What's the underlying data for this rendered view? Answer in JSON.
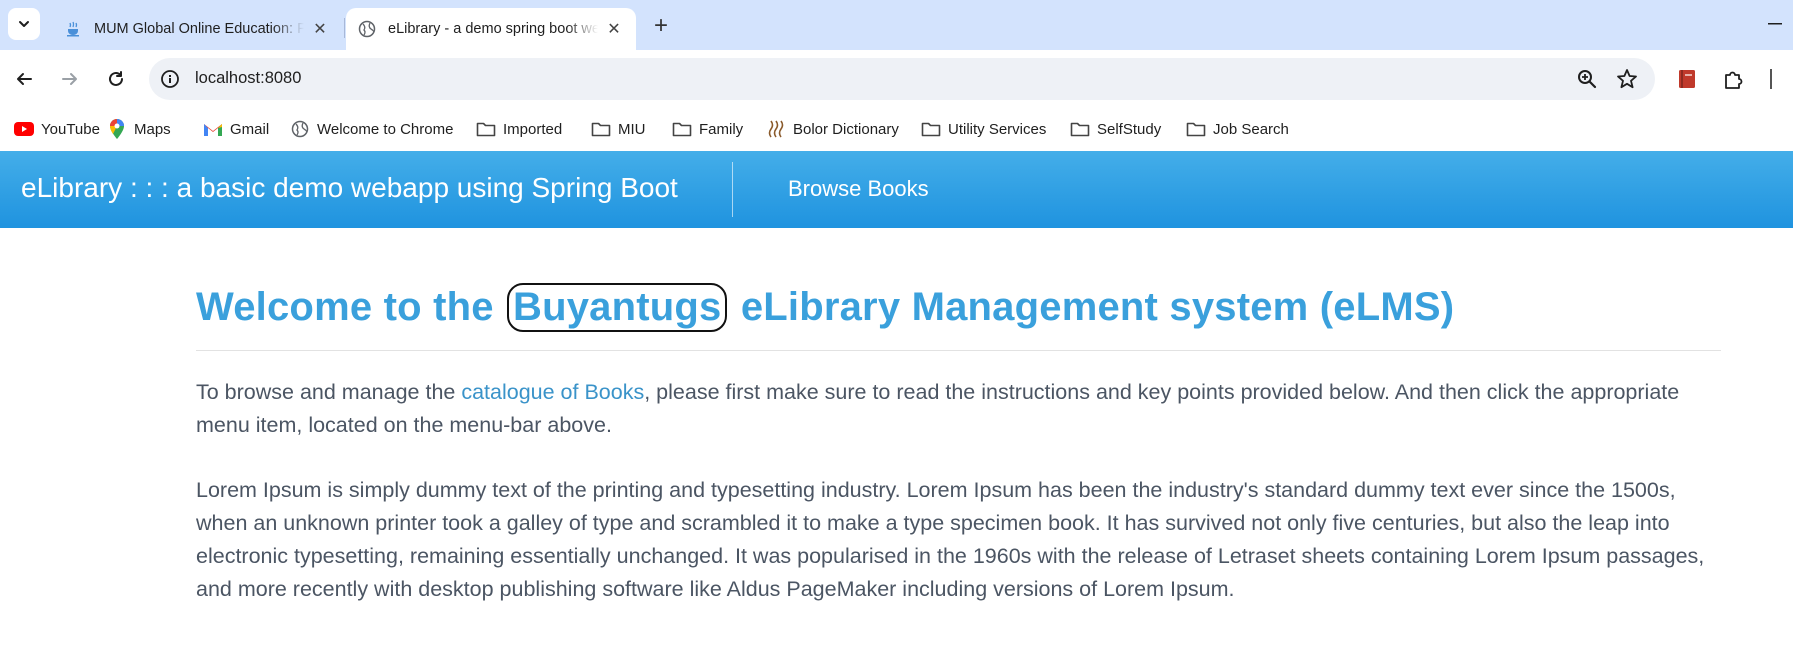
{
  "browser": {
    "tabs": [
      {
        "title": "MUM Global Online Education: Fi",
        "icon": "steam-cup-icon",
        "active": false
      },
      {
        "title": "eLibrary - a demo spring boot web",
        "icon": "globe-icon",
        "active": true
      }
    ],
    "address": "localhost:8080",
    "bookmarks": [
      {
        "label": "YouTube",
        "icon": "youtube-icon"
      },
      {
        "label": "Maps",
        "icon": "maps-pin-icon"
      },
      {
        "label": "Gmail",
        "icon": "gmail-icon"
      },
      {
        "label": "Welcome to Chrome",
        "icon": "globe-icon"
      },
      {
        "label": "Imported",
        "icon": "folder-icon"
      },
      {
        "label": "MIU",
        "icon": "folder-icon"
      },
      {
        "label": "Family",
        "icon": "folder-icon"
      },
      {
        "label": "Bolor Dictionary",
        "icon": "dictionary-icon"
      },
      {
        "label": "Utility Services",
        "icon": "folder-icon"
      },
      {
        "label": "SelfStudy",
        "icon": "folder-icon"
      },
      {
        "label": "Job Search",
        "icon": "folder-icon"
      }
    ]
  },
  "page": {
    "brand": "eLibrary : : : a basic demo webapp using Spring Boot",
    "nav_link": "Browse Books",
    "heading": {
      "before": "Welcome to the",
      "highlight": "Buyantugs",
      "after": "eLibrary Management system (eLMS)"
    },
    "intro": {
      "before": "To browse and manage the ",
      "link": "catalogue of Books",
      "after": ", please first make sure to read the instructions and key points provided below. And then click the appropriate menu item, located on the menu-bar above."
    },
    "lorem": "Lorem Ipsum is simply dummy text of the printing and typesetting industry. Lorem Ipsum has been the industry's standard dummy text ever since the 1500s, when an unknown printer took a galley of type and scrambled it to make a type specimen book. It has survived not only five centuries, but also the leap into electronic typesetting, remaining essentially unchanged. It was popularised in the 1960s with the release of Letraset sheets containing Lorem Ipsum passages, and more recently with desktop publishing software like Aldus PageMaker including versions of Lorem Ipsum."
  },
  "colors": {
    "nav_gradient_top": "#44aee9",
    "nav_gradient_bottom": "#1f93df",
    "heading": "#3aa0dc",
    "link": "#3a93c9",
    "body_text": "#4b5563",
    "tabstrip": "#d3e3fd"
  }
}
